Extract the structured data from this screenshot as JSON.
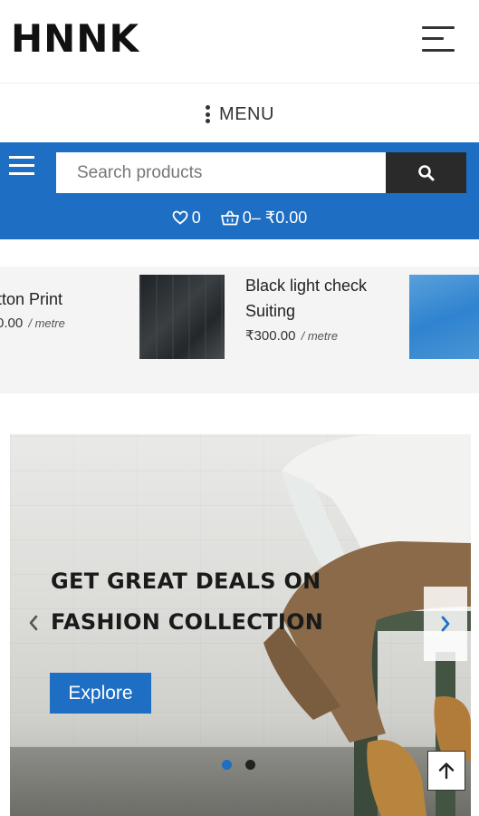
{
  "header": {
    "logo": "HNNK",
    "menu_icon": "hamburger-icon"
  },
  "menu_toggle": {
    "label": "MENU",
    "icon": "kebab-icon"
  },
  "search": {
    "placeholder": "Search products",
    "button_icon": "search-icon"
  },
  "cart_bar": {
    "wishlist_count": "0",
    "cart_summary": "0– ₹0.00"
  },
  "products": [
    {
      "name": "tton Print",
      "price": "0.00",
      "unit": "/ metre"
    },
    {
      "name": "Black light check Suiting",
      "price": "₹300.00",
      "unit": "/ metre"
    }
  ],
  "hero": {
    "title_line1": "GET GREAT DEALS ON",
    "title_line2": "FASHION COLLECTION",
    "cta": "Explore",
    "slide_count": 2,
    "active_slide": 1
  },
  "colors": {
    "brand_blue": "#1e6fc3",
    "dark": "#2a2a2a"
  }
}
